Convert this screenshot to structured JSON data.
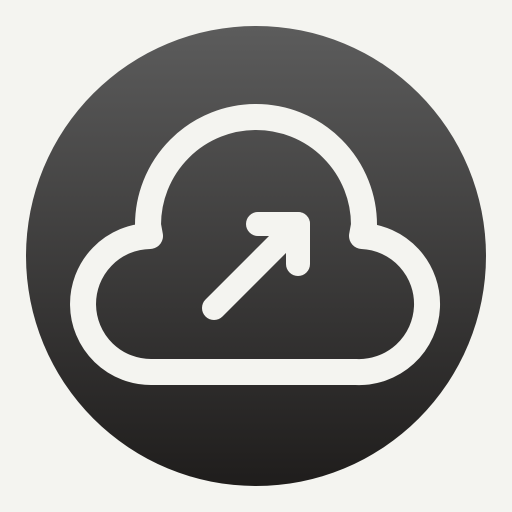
{
  "icon": {
    "name": "cloud-upload-icon",
    "description_glyphs": [
      "cloud-icon",
      "arrow-up-right-icon"
    ]
  },
  "colors": {
    "page_background": "#f4f4f0",
    "badge_top": "#5c5c5c",
    "badge_bottom": "#1f1d1c",
    "glyph": "#f4f4f0"
  }
}
